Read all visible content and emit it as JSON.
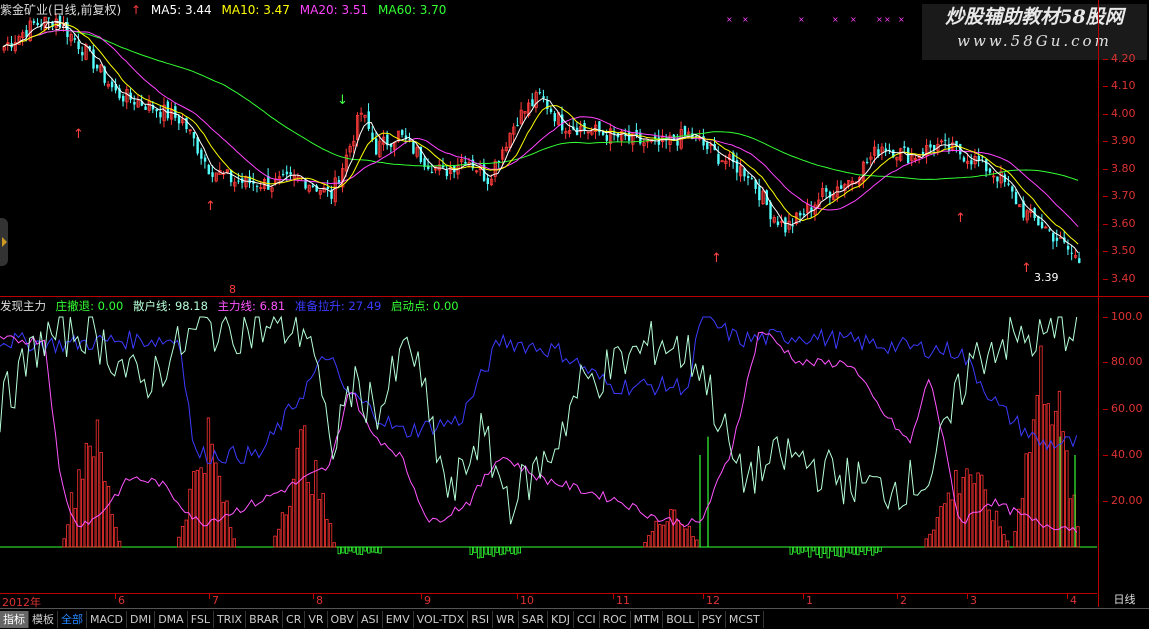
{
  "main": {
    "title": "紫金矿业(日线,前复权)",
    "ma5": "MA5: 3.44",
    "ma10": "MA10: 3.47",
    "ma20": "MA20: 3.51",
    "ma60": "MA60: 3.70",
    "high_label": "4.34",
    "low_label": "3.39",
    "marker_8": "8",
    "price_ticks": [
      "4.20",
      "4.10",
      "4.00",
      "3.90",
      "3.80",
      "3.70",
      "3.60",
      "3.50",
      "3.40"
    ]
  },
  "indicator": {
    "name": "发现主力",
    "l1": "庄撤退: 0.00",
    "l2": "散户线: 98.18",
    "l3": "主力线: 6.81",
    "l4": "准备拉升: 27.49",
    "l5": "启动点: 0.00",
    "ticks": [
      "100.0",
      "80.00",
      "60.00",
      "40.00",
      "20.00"
    ]
  },
  "dates": [
    "2012年",
    "6",
    "7",
    "8",
    "9",
    "10",
    "11",
    "12",
    "1",
    "2",
    "3",
    "4"
  ],
  "period": "日线",
  "watermark": {
    "line1": "炒股辅助教材58股网",
    "line2": "www.58Gu.com"
  },
  "tabs": [
    "指标",
    "模板",
    "全部",
    "MACD",
    "DMI",
    "DMA",
    "FSL",
    "TRIX",
    "BRAR",
    "CR",
    "VR",
    "OBV",
    "ASI",
    "EMV",
    "VOL-TDX",
    "RSI",
    "WR",
    "SAR",
    "KDJ",
    "CCI",
    "ROC",
    "MTM",
    "BOLL",
    "PSY",
    "MCST"
  ],
  "colors": {
    "up": "#ff3b3b",
    "down": "#54ffff",
    "ma5": "#ffffff",
    "ma10": "#ffff00",
    "ma20": "#ff44ff",
    "ma60": "#33ff33",
    "retail": "#b6ffd8",
    "main_line": "#ff55ff",
    "dealer": "#3b3bff",
    "bars": "#ff3333",
    "neg": "#33ff33"
  }
}
